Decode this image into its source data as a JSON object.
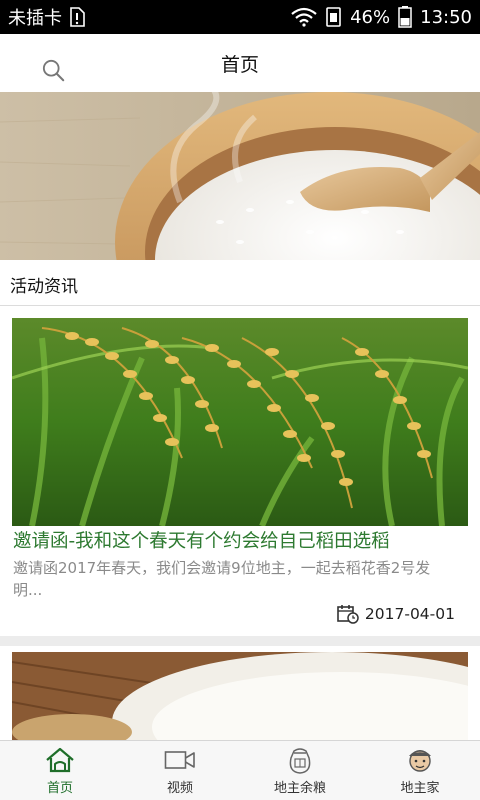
{
  "status_bar": {
    "carrier": "未插卡",
    "battery": "46%",
    "time": "13:50"
  },
  "header": {
    "title": "首页",
    "search_icon": "search-icon"
  },
  "section": {
    "title": "活动资讯"
  },
  "articles": [
    {
      "title": "邀请函-我和这个春天有个约会给自己稻田选稻",
      "desc": "邀请函2017年春天，我们会邀请9位地主，一起去稻花香2号发明...",
      "date": "2017-04-01"
    }
  ],
  "tabs": [
    {
      "label": "首页",
      "icon": "home-icon",
      "active": true
    },
    {
      "label": "视频",
      "icon": "video-icon",
      "active": false
    },
    {
      "label": "地主余粮",
      "icon": "rice-bag-icon",
      "active": false
    },
    {
      "label": "地主家",
      "icon": "farmer-avatar-icon",
      "active": false
    }
  ],
  "colors": {
    "accent": "#2e7a31",
    "tab_active": "#1f6e2a",
    "status_bar": "#000000"
  }
}
